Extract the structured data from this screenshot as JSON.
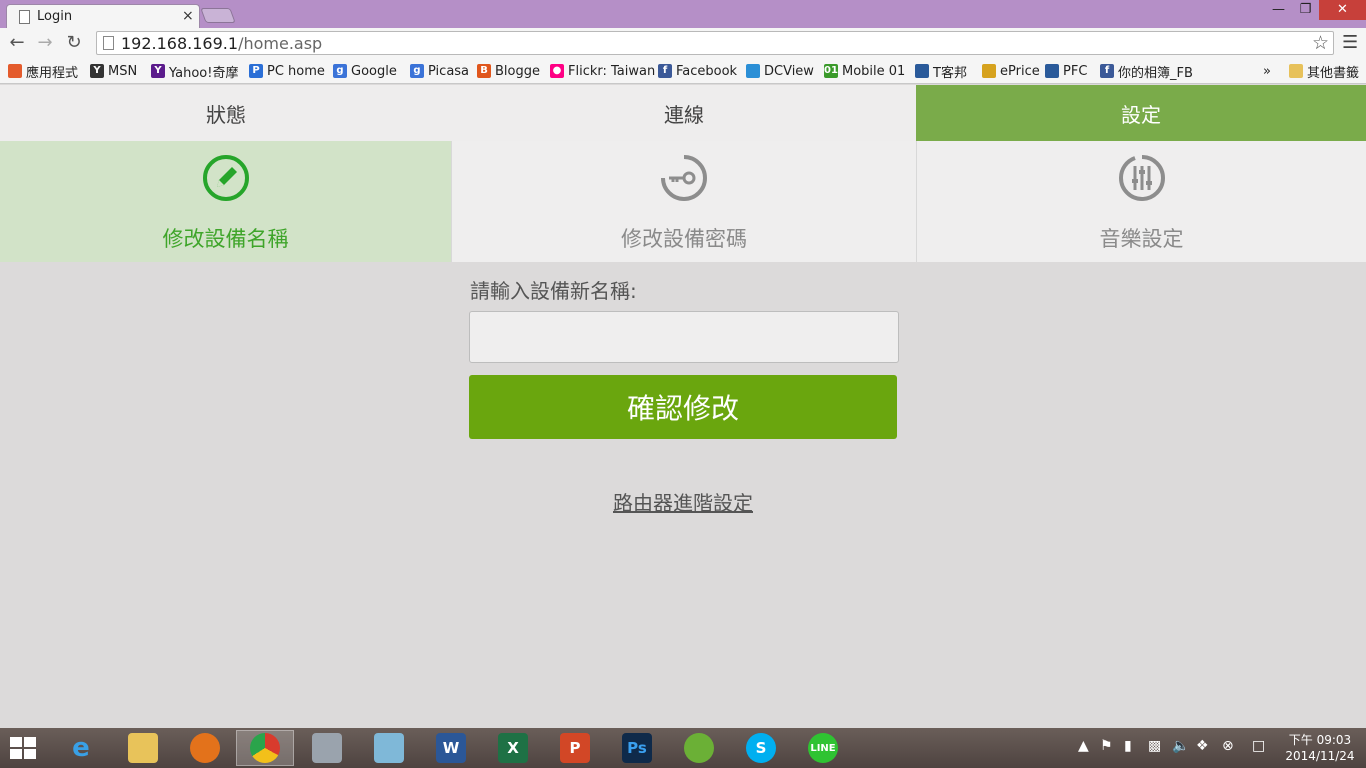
{
  "browser": {
    "tab_title": "Login",
    "tab_close": "×",
    "url_host": "192.168.169.1",
    "url_path": "/home.asp",
    "bookmarks": [
      {
        "label": "應用程式",
        "icon": "apps-icon",
        "color": "#e45b2c"
      },
      {
        "label": "MSN",
        "icon": "msn-icon",
        "color": "#333333"
      },
      {
        "label": "Yahoo!奇摩",
        "icon": "yahoo-icon",
        "color": "#5b1b8c"
      },
      {
        "label": "PC home",
        "icon": "pchome-icon",
        "color": "#2b6fd6"
      },
      {
        "label": "Google",
        "icon": "google-icon",
        "color": "#3b73d8"
      },
      {
        "label": "Picasa",
        "icon": "picasa-icon",
        "color": "#3b73d8"
      },
      {
        "label": "Blogge",
        "icon": "blogger-icon",
        "color": "#e0561c"
      },
      {
        "label": "Flickr: Taiwan",
        "icon": "flickr-icon",
        "color": "#ff0084"
      },
      {
        "label": "Facebook",
        "icon": "facebook-icon",
        "color": "#3b5998"
      },
      {
        "label": "DCView",
        "icon": "dcview-icon",
        "color": "#2b8fd6"
      },
      {
        "label": "Mobile 01",
        "icon": "mobile01-icon",
        "color": "#3a9a2a"
      },
      {
        "label": "T客邦",
        "icon": "tkb-icon",
        "color": "#2a5a9a"
      },
      {
        "label": "ePrice",
        "icon": "eprice-icon",
        "color": "#d6a21e"
      },
      {
        "label": "PFC",
        "icon": "pfc-icon",
        "color": "#2a5a9a"
      },
      {
        "label": "你的相簿_FB",
        "icon": "facebook-icon",
        "color": "#3b5998"
      }
    ],
    "more_bookmarks": "»",
    "other_bookmarks": "其他書籤"
  },
  "app": {
    "nav_tabs": [
      {
        "label": "狀態",
        "active": false
      },
      {
        "label": "連線",
        "active": false
      },
      {
        "label": "設定",
        "active": true
      }
    ],
    "sub_tabs": [
      {
        "label": "修改設備名稱",
        "icon": "pencil-circle-icon",
        "active": true
      },
      {
        "label": "修改設備密碼",
        "icon": "key-circle-icon",
        "active": false
      },
      {
        "label": "音樂設定",
        "icon": "equalizer-circle-icon",
        "active": false
      }
    ],
    "form": {
      "label": "請輸入設備新名稱:",
      "input_value": "",
      "confirm_label": "確認修改",
      "advanced_link": "路由器進階設定"
    },
    "colors": {
      "accent": "#7aab4a",
      "button": "#6aa60e",
      "active_sub": "#d2e3c8",
      "active_text": "#3fa52a"
    }
  },
  "taskbar": {
    "apps": [
      "internet-explorer-icon",
      "file-explorer-icon",
      "firefox-icon",
      "chrome-icon",
      "calculator-icon",
      "notes-icon",
      "word-icon",
      "excel-icon",
      "powerpoint-icon",
      "photoshop-icon",
      "app-icon",
      "skype-icon",
      "line-icon"
    ],
    "clock_period": "下午 09:03",
    "clock_date": "2014/11/24"
  }
}
